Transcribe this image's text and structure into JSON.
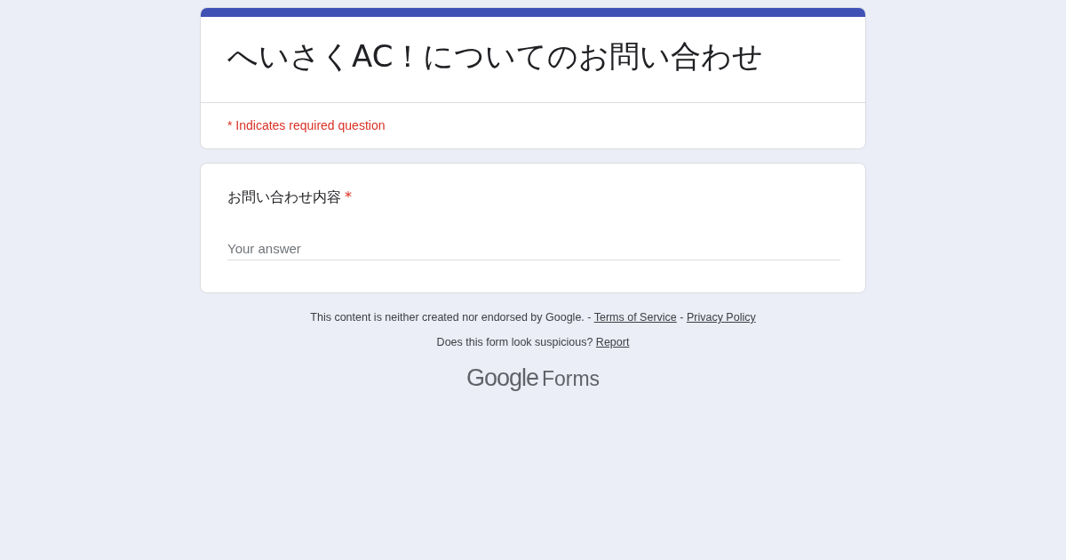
{
  "form": {
    "title": "へいさくAC！についてのお問い合わせ",
    "required_notice": "* Indicates required question"
  },
  "questions": [
    {
      "label": "お問い合わせ内容",
      "required": true,
      "required_mark": "*",
      "placeholder": "Your answer"
    }
  ],
  "footer": {
    "disclaimer": "This content is neither created nor endorsed by Google.",
    "separator_1": "-",
    "terms_link": "Terms of Service",
    "separator_2": "-",
    "privacy_link": "Privacy Policy",
    "suspicious_text": "Does this form look suspicious?",
    "report_link": "Report"
  },
  "logo": {
    "brand": "Google",
    "product": "Forms"
  }
}
